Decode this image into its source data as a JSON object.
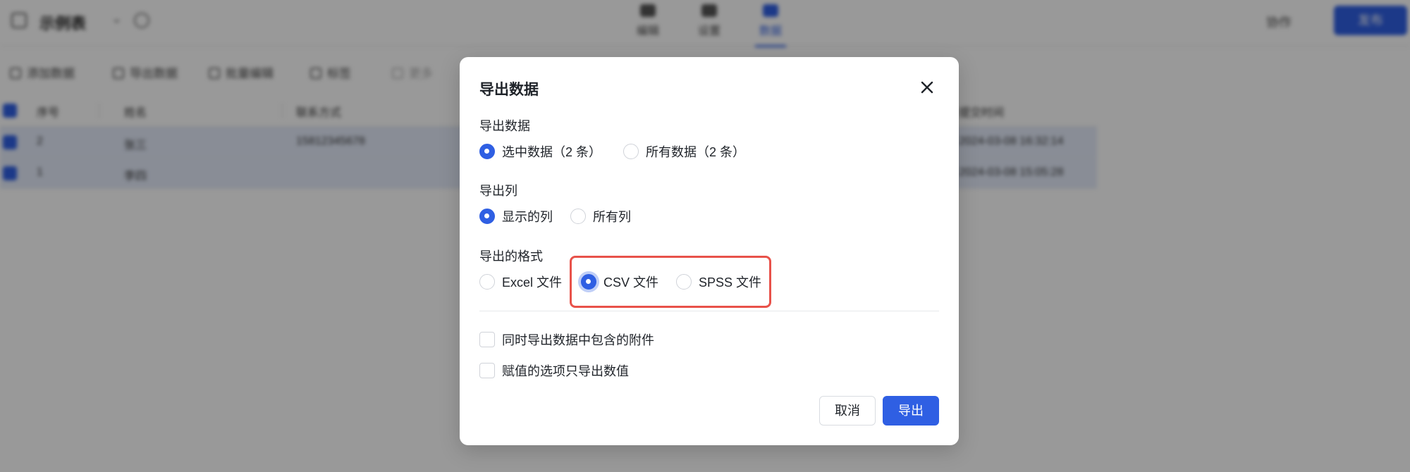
{
  "app": {
    "title": "示例表",
    "tabs": [
      {
        "label": "编辑",
        "active": false
      },
      {
        "label": "设置",
        "active": false
      },
      {
        "label": "数据",
        "active": true
      }
    ],
    "user_label": "协作",
    "primary_button": "发布"
  },
  "toolbar": {
    "items": [
      "添加数据",
      "导出数据",
      "批量编辑",
      "标签",
      "更多"
    ]
  },
  "table": {
    "columns": [
      "序号",
      "姓名",
      "联系方式",
      "提交时间"
    ],
    "rows": [
      {
        "cells": [
          "2",
          "张三",
          "15812345678",
          "2024-03-08 16:32:14"
        ]
      },
      {
        "cells": [
          "1",
          "李四",
          "",
          "2024-03-08 15:05:28"
        ]
      }
    ]
  },
  "dialog": {
    "title": "导出数据",
    "close_icon": "close-icon",
    "sections": {
      "data": {
        "label": "导出数据",
        "options": [
          {
            "label": "选中数据（2 条）",
            "checked": true
          },
          {
            "label": "所有数据（2 条）",
            "checked": false
          }
        ]
      },
      "columns": {
        "label": "导出列",
        "options": [
          {
            "label": "显示的列",
            "checked": true
          },
          {
            "label": "所有列",
            "checked": false
          }
        ]
      },
      "format": {
        "label": "导出的格式",
        "options": [
          {
            "label": "Excel 文件",
            "checked": false
          },
          {
            "label": "CSV 文件",
            "checked": true
          },
          {
            "label": "SPSS 文件",
            "checked": false
          }
        ]
      }
    },
    "checkboxes": [
      {
        "label": "同时导出数据中包含的附件",
        "checked": false
      },
      {
        "label": "赋值的选项只导出数值",
        "checked": false
      }
    ],
    "buttons": {
      "cancel": "取消",
      "export": "导出"
    }
  },
  "colors": {
    "accent": "#2f5fe3",
    "highlight": "#e8524a",
    "overlay": "rgba(0,0,0,0.40)"
  }
}
